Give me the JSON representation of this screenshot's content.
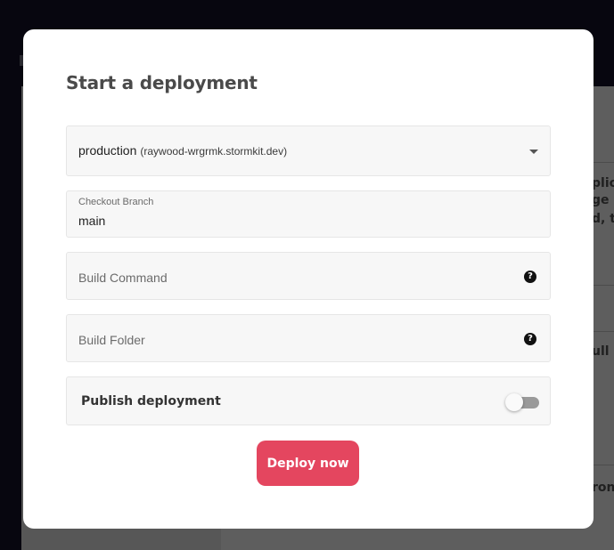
{
  "modal": {
    "title": "Start a deployment",
    "environment": {
      "name": "production",
      "host": "(raywood-wrgrmk.stormkit.dev)"
    },
    "branch": {
      "label": "Checkout Branch",
      "value": "main"
    },
    "build_command": {
      "placeholder": "Build Command",
      "help_icon": "question-circle-icon",
      "help_glyph": "?"
    },
    "build_folder": {
      "placeholder": "Build Folder",
      "help_icon": "question-circle-icon",
      "help_glyph": "?"
    },
    "publish": {
      "label": "Publish deployment",
      "enabled": false
    },
    "deploy_button": "Deploy now"
  },
  "background": {
    "fragments": [
      "plic",
      "ge it",
      "d, th",
      "ull l",
      "ronr"
    ]
  },
  "colors": {
    "accent": "#e4465f",
    "overlay": "#07060f",
    "modal_bg": "#ffffff",
    "field_bg": "#f7f7f7"
  }
}
